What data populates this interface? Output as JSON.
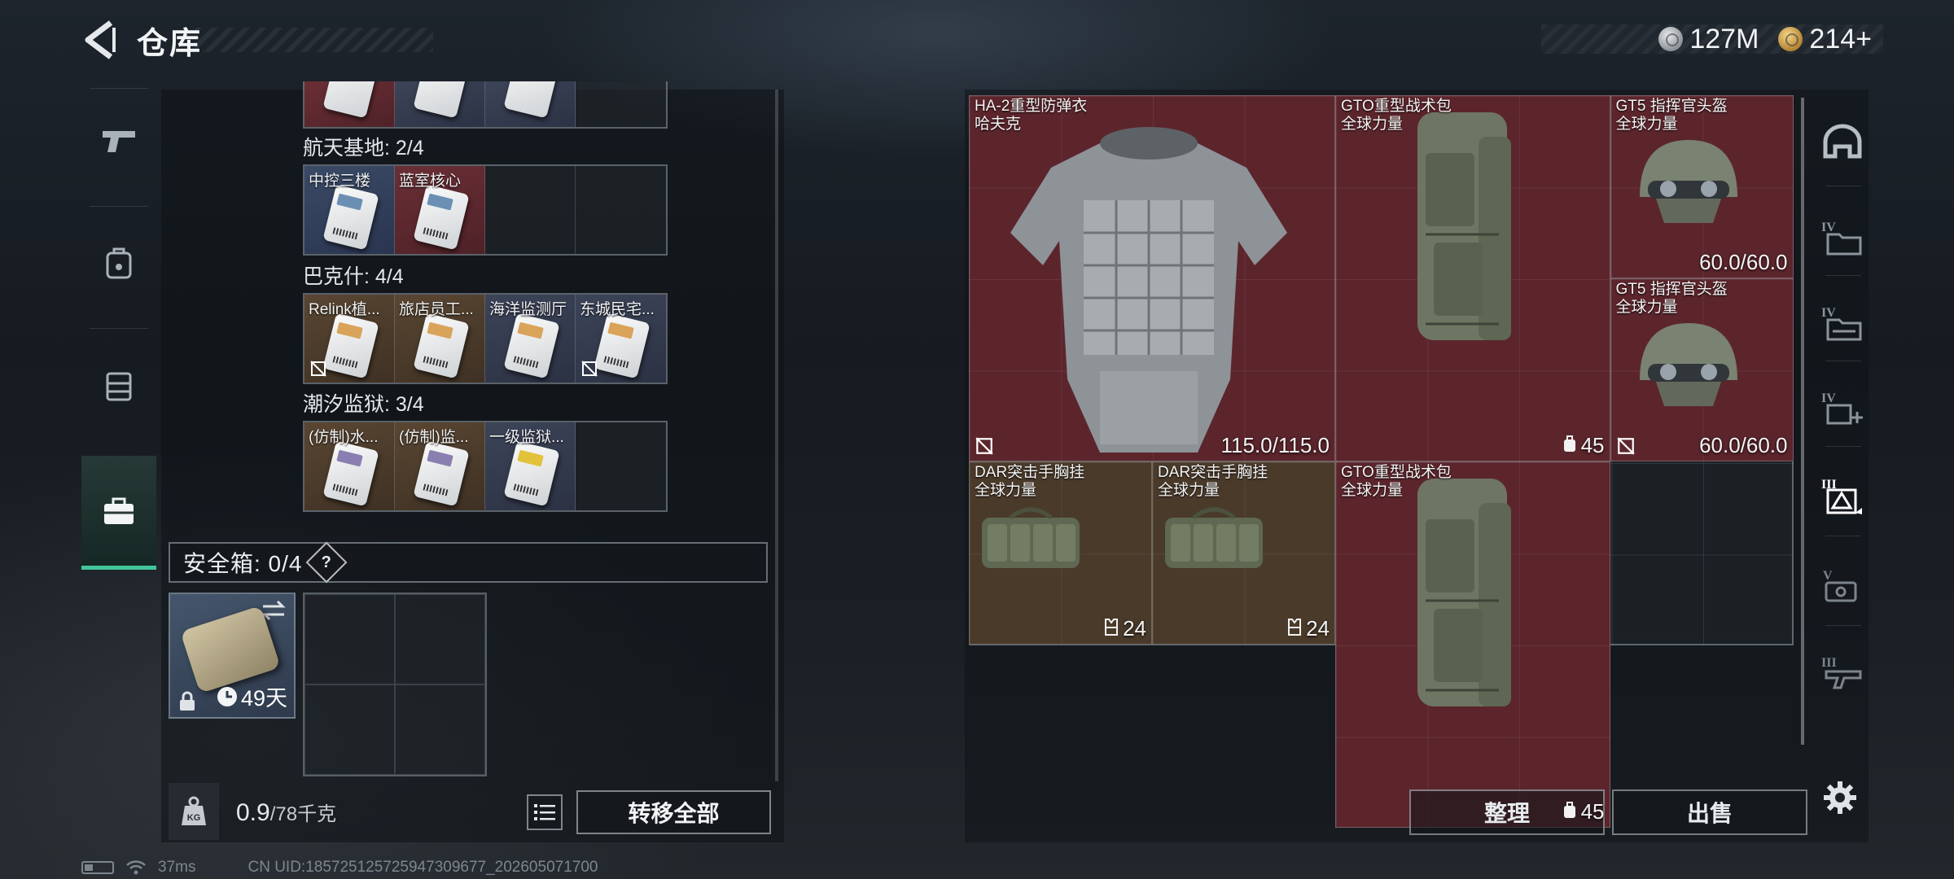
{
  "header": {
    "title": "仓库",
    "currencies": [
      {
        "icon": "silver-coin-icon",
        "amount": "127M"
      },
      {
        "icon": "gold-coin-icon",
        "amount": "214+"
      }
    ]
  },
  "left_nav": {
    "items": [
      {
        "icon": "gun-icon",
        "active": false
      },
      {
        "icon": "backpack-icon",
        "active": false
      },
      {
        "icon": "chest-rig-icon",
        "active": false
      },
      {
        "icon": "briefcase-icon",
        "active": true
      }
    ]
  },
  "keycards": {
    "sections": [
      {
        "title": "航天基地: 2/4",
        "slots": [
          {
            "label": "中控三楼",
            "color": "blue",
            "card": true,
            "accent": "#6b8fb3"
          },
          {
            "label": "蓝室核心",
            "color": "red",
            "card": true,
            "accent": "#6b8fb3"
          },
          {
            "label": "",
            "color": "empty",
            "card": false
          },
          {
            "label": "",
            "color": "empty",
            "card": false
          }
        ]
      },
      {
        "title": "巴克什: 4/4",
        "slots": [
          {
            "label": "Relink植...",
            "color": "brown",
            "card": true,
            "accent": "#d9a35a",
            "locked": true
          },
          {
            "label": "旅店员工...",
            "color": "brown",
            "card": true,
            "accent": "#d9a35a"
          },
          {
            "label": "海洋监测厅",
            "color": "slate",
            "card": true,
            "accent": "#d9a35a"
          },
          {
            "label": "东城民宅...",
            "color": "slate",
            "card": true,
            "accent": "#d9a35a",
            "locked": true
          }
        ]
      },
      {
        "title": "潮汐监狱: 3/4",
        "slots": [
          {
            "label": "(仿制)水...",
            "color": "brown",
            "card": true,
            "accent": "#8a7fb0"
          },
          {
            "label": "(仿制)监...",
            "color": "brown",
            "card": true,
            "accent": "#8a7fb0"
          },
          {
            "label": "一级监狱...",
            "color": "slate",
            "card": true,
            "accent": "#e2c23a"
          },
          {
            "label": "",
            "color": "empty",
            "card": false
          }
        ]
      }
    ]
  },
  "safe_box": {
    "title": "安全箱: 0/4",
    "help": "?",
    "days": "49天"
  },
  "bottom_left": {
    "weight_value": "0.9",
    "weight_max": "/78千克",
    "transfer_all": "转移全部"
  },
  "stash": {
    "items": [
      {
        "id": "armor",
        "name_lines": [
          "HA-2重型防弹衣",
          "哈夫克"
        ],
        "stat": "115.0/115.0",
        "color": "red",
        "locked": true,
        "art": "armor"
      },
      {
        "id": "bag1",
        "name_lines": [
          "GTO重型战术包",
          "全球力量"
        ],
        "stat": "45",
        "stat_icon": "backpack",
        "color": "red",
        "art": "bag"
      },
      {
        "id": "helmet1",
        "name_lines": [
          "GT5 指挥官头盔",
          "全球力量"
        ],
        "stat": "60.0/60.0",
        "color": "red",
        "art": "helmet"
      },
      {
        "id": "helmet2",
        "name_lines": [
          "GT5 指挥官头盔",
          "全球力量"
        ],
        "stat": "60.0/60.0",
        "color": "red",
        "locked": true,
        "art": "helmet"
      },
      {
        "id": "bag2",
        "name_lines": [
          "GTO重型战术包",
          "全球力量"
        ],
        "stat": "45",
        "stat_icon": "backpack",
        "color": "red",
        "art": "bag"
      },
      {
        "id": "rig1",
        "name_lines": [
          "DAR突击手胸挂",
          "全球力量"
        ],
        "stat": "24",
        "stat_icon": "vest",
        "color": "brown",
        "art": "rig"
      },
      {
        "id": "rig2",
        "name_lines": [
          "DAR突击手胸挂",
          "全球力量"
        ],
        "stat": "24",
        "stat_icon": "vest",
        "color": "brown",
        "art": "rig"
      }
    ],
    "sort": "整理",
    "sell": "出售"
  },
  "right_nav": {
    "items": [
      {
        "icon": "helmet-category-icon",
        "active": false
      },
      {
        "icon": "folder-iv-icon",
        "active": false
      },
      {
        "icon": "folder-iv-2-icon",
        "active": false
      },
      {
        "icon": "medical-iv-icon",
        "active": false
      },
      {
        "icon": "armor-iii-icon",
        "active": true
      },
      {
        "icon": "case-v-icon",
        "active": false
      },
      {
        "icon": "weapon-iii-icon",
        "active": false
      }
    ]
  },
  "status_bar": {
    "ping": "37ms",
    "uid": "CN UID:1857251257259473096​77_202605071700"
  }
}
